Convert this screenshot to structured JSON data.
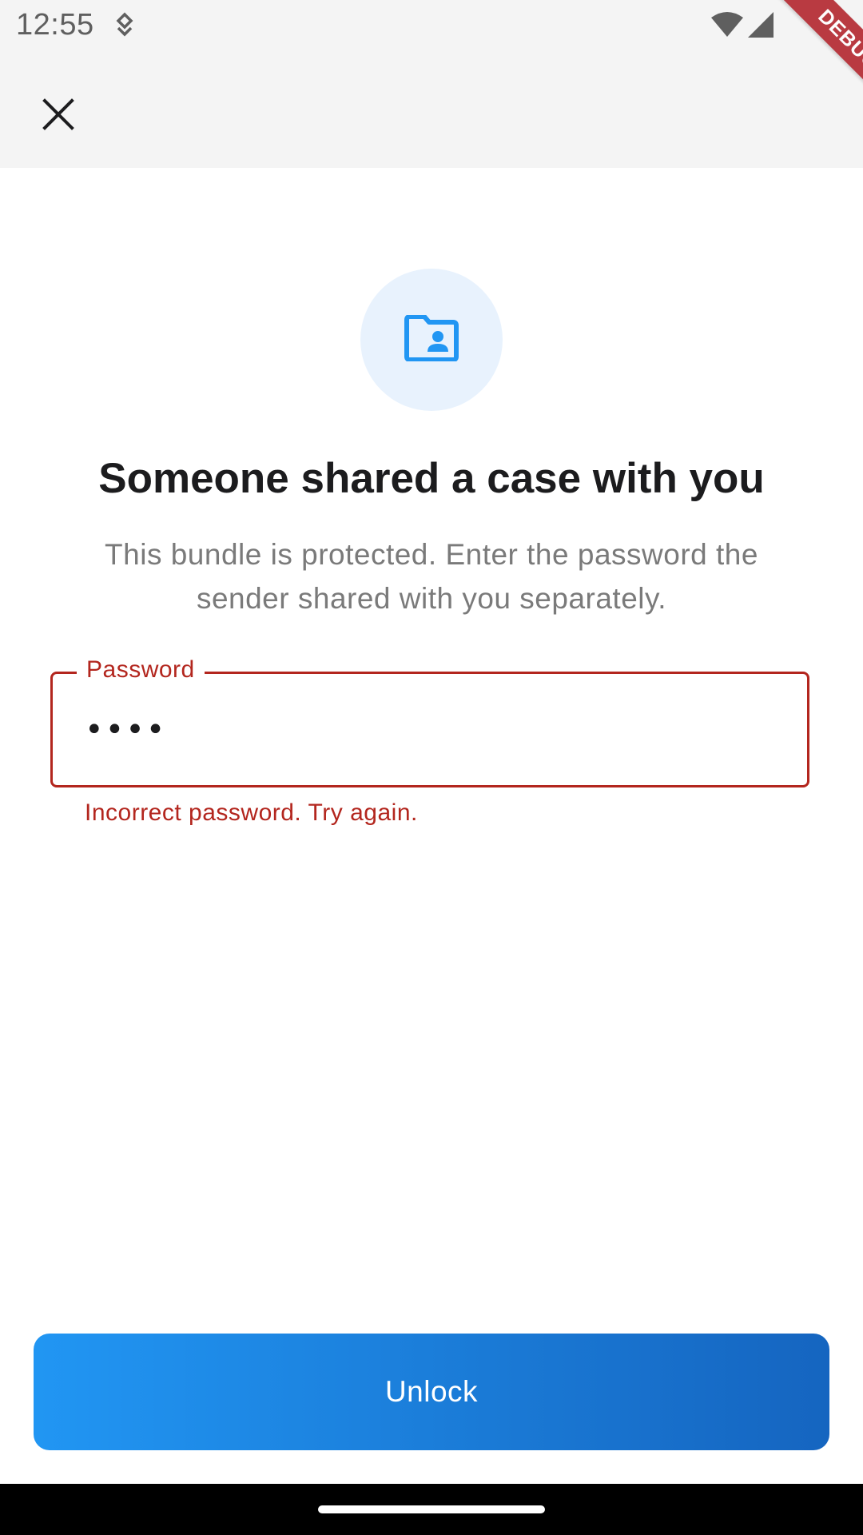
{
  "status_bar": {
    "time": "12:55",
    "icons": [
      "notification-icon",
      "wifi-icon",
      "signal-icon"
    ]
  },
  "app_bar": {
    "close_icon": "close-icon"
  },
  "debug_banner": {
    "label": "DEBUG",
    "color": "#b3262e"
  },
  "main": {
    "header_icon": "folder-shared-icon",
    "title": "Someone shared a case with you",
    "subtitle": "This bundle is protected. Enter the password the sender shared with you separately."
  },
  "password_field": {
    "label": "Password",
    "value": "••••",
    "error": "Incorrect password. Try again."
  },
  "actions": {
    "unlock_label": "Unlock"
  },
  "colors": {
    "accent": "#2196f3",
    "accent_dark": "#1565c0",
    "error": "#b3261e",
    "icon_bg": "#e8f2fd"
  }
}
